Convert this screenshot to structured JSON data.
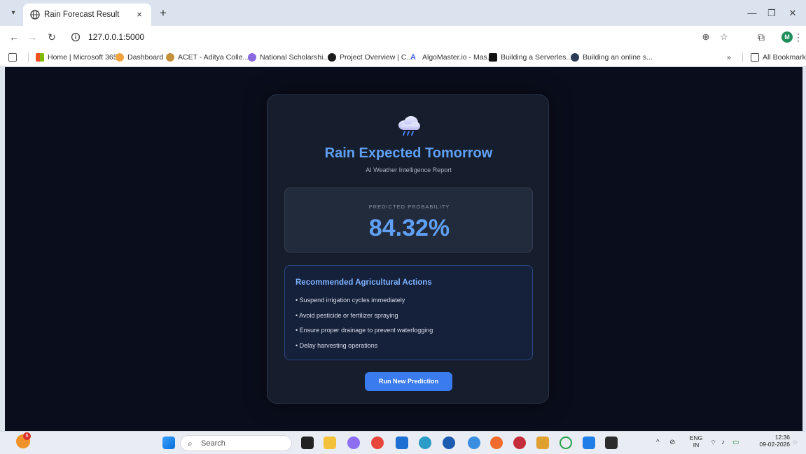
{
  "browser": {
    "tab_title": "Rain Forecast Result",
    "tab_close": "×",
    "new_tab": "+",
    "url": "127.0.0.1:5000",
    "bookmarks": [
      "Home | Microsoft 365",
      "Dashboard",
      "ACET - Aditya Colle...",
      "National Scholarshi...",
      "Project Overview | C...",
      "AlgoMaster.io - Mas...",
      "Building a Serverles...",
      "Building an online s..."
    ],
    "overflow": "»",
    "all_bookmarks": "All Bookmarks",
    "profile_initial": "M"
  },
  "page": {
    "title": "Rain Expected Tomorrow",
    "subtitle": "AI Weather Intelligence Report",
    "probability_label": "PREDICTED PROBABILITY",
    "probability_value": "84.32%",
    "actions_title": "Recommended Agricultural Actions",
    "actions": [
      "• Suspend irrigation cycles immediately",
      "• Avoid pesticide or fertilizer spraying",
      "• Ensure proper drainage to prevent waterlogging",
      "• Delay harvesting operations"
    ],
    "run_button": "Run New Prediction"
  },
  "taskbar": {
    "search_placeholder": "Search",
    "language": "ENG",
    "region": "IN",
    "time": "12:36",
    "date": "09-02-2026",
    "weather_badge": "6"
  },
  "colors": {
    "accent": "#5fa0f5",
    "page_bg": "#0a0e1c",
    "card_bg": "#161d2c",
    "button": "#3b7bf0"
  }
}
